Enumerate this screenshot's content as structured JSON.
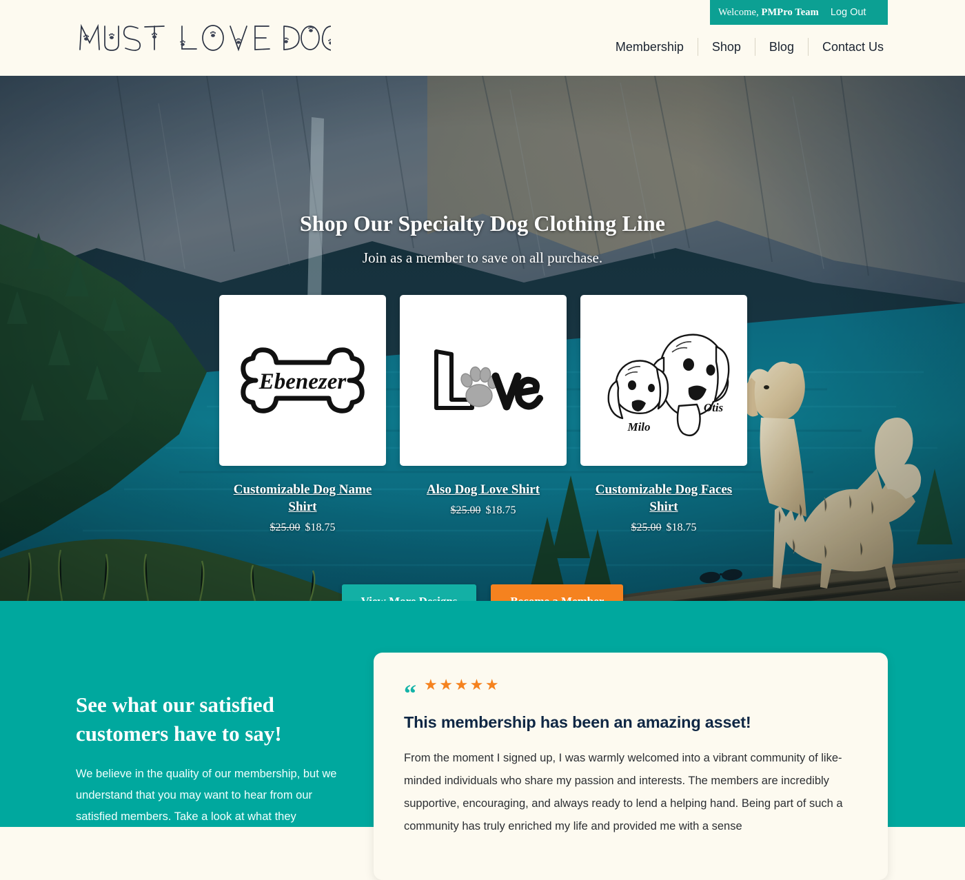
{
  "theme": {
    "cream": "#FDFAF0",
    "teal": "#00A89E",
    "teal_dark": "#0CA093",
    "teal_button": "#13B0A5",
    "orange": "#F5821F",
    "navy": "#0F2744"
  },
  "header": {
    "logo_text": "MUST LOVE DOGS",
    "welcome": {
      "greeting_prefix": "Welcome, ",
      "user_name": "PMPro Team",
      "logout_label": "Log Out"
    },
    "nav": [
      {
        "label": "Membership"
      },
      {
        "label": "Shop"
      },
      {
        "label": "Blog"
      },
      {
        "label": "Contact Us"
      }
    ]
  },
  "hero": {
    "title": "Shop Our Specialty Dog Clothing Line",
    "subtitle": "Join as a member to save on all purchase.",
    "products": [
      {
        "title": "Customizable Dog Name Shirt",
        "art": "dog-bone-name",
        "art_text": "Ebenezer",
        "price_old": "$25.00",
        "price_new": "$18.75"
      },
      {
        "title": "Also Dog Love Shirt",
        "art": "love-pawprint",
        "art_text": "Love",
        "price_old": "$25.00",
        "price_new": "$18.75"
      },
      {
        "title": "Customizable Dog Faces Shirt",
        "art": "two-dog-faces",
        "art_text": "Milo / Otis",
        "price_old": "$25.00",
        "price_new": "$18.75"
      }
    ],
    "buttons": {
      "view_more_label": "View More Designs",
      "become_member_label": "Become a Member"
    }
  },
  "testimonials": {
    "heading": "See what our satisfied customers have to say!",
    "intro": "We believe in the quality of our membership, but we understand that you may want to hear from our satisfied members. Take a look at what they",
    "card": {
      "quote_glyph": "“",
      "rating_stars": "★★★★★",
      "rating_value": 5,
      "title": "This membership has been an amazing asset!",
      "body": "From the moment I signed up, I was warmly welcomed into a vibrant community of like-minded individuals who share my passion and interests. The members are incredibly supportive, encouraging, and always ready to lend a helping hand. Being part of such a community has truly enriched my life and provided me with a sense"
    }
  }
}
